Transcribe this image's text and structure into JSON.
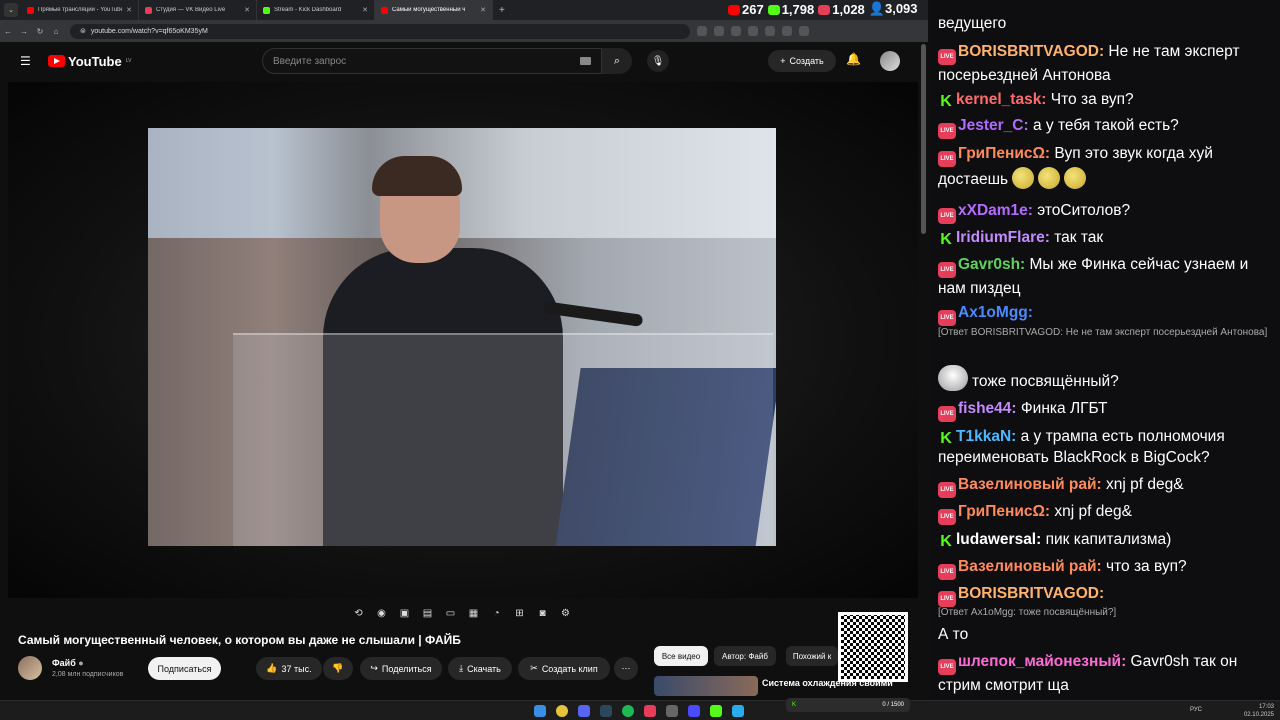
{
  "browser": {
    "tabs": [
      {
        "title": "Прямые трансляции - YouTube",
        "icon": "youtube-icon",
        "color": "#ff0000"
      },
      {
        "title": "Студия — VK Видео Live",
        "icon": "vk-icon",
        "color": "#e53d5a"
      },
      {
        "title": "Stream - Kick Dashboard",
        "icon": "kick-icon",
        "color": "#53fc18"
      },
      {
        "title": "Самый могущественный ч",
        "icon": "youtube-icon",
        "color": "#ff0000",
        "active": true
      }
    ],
    "url": "youtube.com/watch?v=qf65oKM35yM"
  },
  "stream_stats": [
    {
      "platform": "youtube",
      "value": "267",
      "color": "#ff0000"
    },
    {
      "platform": "kick",
      "value": "1,798",
      "color": "#53fc18"
    },
    {
      "platform": "vk",
      "value": "1,028",
      "color": "#e53d5a"
    },
    {
      "platform": "total",
      "value": "3,093",
      "color": "#4aa3ff"
    }
  ],
  "youtube": {
    "logo_text": "YouTube",
    "logo_region": "LV",
    "search_placeholder": "Введите запрос",
    "create_label": "Создать",
    "video_title": "Самый могущественный человек, о котором вы даже не слышали | ФАЙБ",
    "channel_name": "Файб",
    "channel_subs": "2,08 млн подписчиков",
    "subscribe_label": "Подписаться",
    "likes": "37 тыс.",
    "share_label": "Поделиться",
    "download_label": "Скачать",
    "clip_label": "Создать клип",
    "chips": [
      "Все видео",
      "Автор: Файб",
      "Похожий к"
    ],
    "suggestion_title": "Система охлаждения своими"
  },
  "chat": [
    {
      "type": "text",
      "text": "ведущего"
    },
    {
      "badge": "live",
      "nick": "BORISBRITVAGOD:",
      "color": "#ffb36b",
      "text": " Не не там эксперт посерьездней Антонова"
    },
    {
      "badge": "kick",
      "nick": "kernel_task:",
      "color": "#ff6b6b",
      "text": " Что за вуп?"
    },
    {
      "badge": "live",
      "nick": "Jester_C:",
      "color": "#b36bff",
      "text": " а у тебя такой есть?"
    },
    {
      "badge": "live",
      "nick": "ГриПенисΩ:",
      "color": "#ff8a5a",
      "text": " Вуп это звук когда хуй достаешь"
    },
    {
      "badge": "live",
      "nick": "xXDam1e:",
      "color": "#b36bff",
      "text": " этоСитолов?"
    },
    {
      "badge": "kick",
      "nick": "IridiumFlare:",
      "color": "#c48bff",
      "text": " так так"
    },
    {
      "badge": "live",
      "nick": "Gavr0sh:",
      "color": "#5ed15e",
      "text": " Мы же Финка сейчас узнаем и нам пиздец"
    },
    {
      "badge": "live",
      "nick": "Ax1oMgg:",
      "color": "#4a8bff",
      "text": ""
    },
    {
      "reply": "[Ответ BORISBRITVAGOD: Не не там эксперт посерьездней Антонова]"
    },
    {
      "emote_line": "тоже посвящённый?"
    },
    {
      "badge": "live",
      "nick": "fishe44:",
      "color": "#c48bff",
      "text": " Финка ЛГБТ"
    },
    {
      "badge": "kick",
      "nick": "T1kkaN:",
      "color": "#4ab8ff",
      "text": " а у трампа есть полномочия переименовать BlackRock в BigCock?"
    },
    {
      "badge": "live",
      "nick": "Вазелиновый рай:",
      "color": "#ff8a5a",
      "text": " xnj pf deg&"
    },
    {
      "badge": "live",
      "nick": "ГриПенисΩ:",
      "color": "#ff8a5a",
      "text": " xnj pf deg&"
    },
    {
      "badge": "kick",
      "nick": "ludawersal:",
      "color": "#ffffff",
      "text": " пик капитализма)"
    },
    {
      "badge": "live",
      "nick": "Вазелиновый рай:",
      "color": "#ff8a5a",
      "text": " что за вуп?"
    },
    {
      "badge": "live",
      "nick": "BORISBRITVAGOD:",
      "color": "#ffb36b",
      "text": ""
    },
    {
      "reply": "[Ответ Ax1oMgg: тоже посвящённый?]"
    },
    {
      "type": "text",
      "text": "А то"
    },
    {
      "badge": "live",
      "nick": "шлепок_майонезный:",
      "color": "#ff6bd6",
      "text": " Gavr0sh так он стрим смотрит ща"
    }
  ],
  "taskbar": {
    "lang": "РУС",
    "time": "17:03",
    "date": "02.10.2025",
    "kick_widget": "0 / 1500"
  }
}
